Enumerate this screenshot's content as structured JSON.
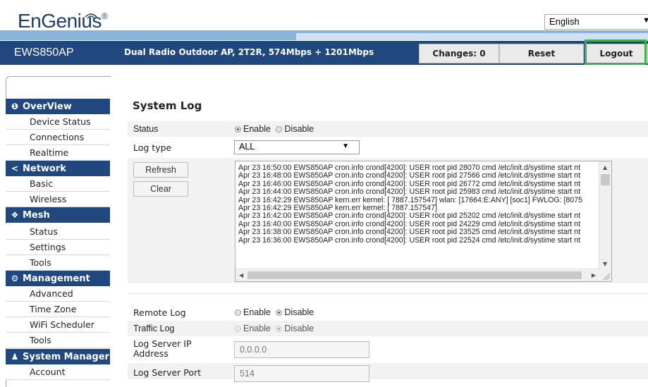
{
  "header": {
    "brand": "EnGenius",
    "brand_mark": "®",
    "language": "English",
    "model": "EWS850AP",
    "description": "Dual Radio Outdoor AP, 2T2R, 574Mbps + 1201Mbps",
    "changes_label": "Changes: 0",
    "reset_label": "Reset",
    "logout_label": "Logout",
    "highlight_color": "#3cb34a"
  },
  "sidebar": {
    "sections": [
      {
        "label": "OverView",
        "icon": "info-icon",
        "items": [
          "Device Status",
          "Connections",
          "Realtime"
        ]
      },
      {
        "label": "Network",
        "icon": "share-icon",
        "items": [
          "Basic",
          "Wireless"
        ]
      },
      {
        "label": "Mesh",
        "icon": "mesh-icon",
        "items": [
          "Status",
          "Settings",
          "Tools"
        ]
      },
      {
        "label": "Management",
        "icon": "gear-icon",
        "items": [
          "Advanced",
          "Time Zone",
          "WiFi Scheduler",
          "Tools"
        ]
      },
      {
        "label": "System Manager",
        "icon": "user-icon",
        "items": [
          "Account"
        ]
      }
    ]
  },
  "main": {
    "title": "System Log",
    "status": {
      "label": "Status",
      "enable": "Enable",
      "disable": "Disable",
      "selected": "Enable"
    },
    "log_type": {
      "label": "Log type",
      "value": "ALL"
    },
    "refresh_label": "Refresh",
    "clear_label": "Clear",
    "log_lines": [
      "Apr 23 16:50:00 EWS850AP cron.info crond[4200]: USER root pid 28070 cmd /etc/init.d/systime start nt",
      "Apr 23 16:48:00 EWS850AP cron.info crond[4200]: USER root pid 27566 cmd /etc/init.d/systime start nt",
      "Apr 23 16:46:00 EWS850AP cron.info crond[4200]: USER root pid 26772 cmd /etc/init.d/systime start nt",
      "Apr 23 16:44:00 EWS850AP cron.info crond[4200]: USER root pid 25983 cmd /etc/init.d/systime start nt",
      "Apr 23 16:42:29 EWS850AP kern.err kernel: [ 7887.157547] wlan: [17664:E:ANY] [soc1] FWLOG: [8075",
      "Apr 23 16:42:29 EWS850AP kern.err kernel: [ 7887.157547]",
      "Apr 23 16:42:00 EWS850AP cron.info crond[4200]: USER root pid 25202 cmd /etc/init.d/systime start nt",
      "Apr 23 16:40:00 EWS850AP cron.info crond[4200]: USER root pid 24229 cmd /etc/init.d/systime start nt",
      "Apr 23 16:38:00 EWS850AP cron.info crond[4200]: USER root pid 23525 cmd /etc/init.d/systime start nt",
      "Apr 23 16:36:00 EWS850AP cron.info crond[4200]: USER root pid 22524 cmd /etc/init.d/systime start nt"
    ],
    "remote_log": {
      "label": "Remote Log",
      "enable": "Enable",
      "disable": "Disable",
      "selected": "Disable"
    },
    "traffic_log": {
      "label": "Traffic Log",
      "enable": "Enable",
      "disable": "Disable",
      "selected": "Disable"
    },
    "server_ip": {
      "label": "Log Server IP Address",
      "value": "0.0.0.0"
    },
    "server_port": {
      "label": "Log Server Port",
      "value": "514"
    }
  }
}
